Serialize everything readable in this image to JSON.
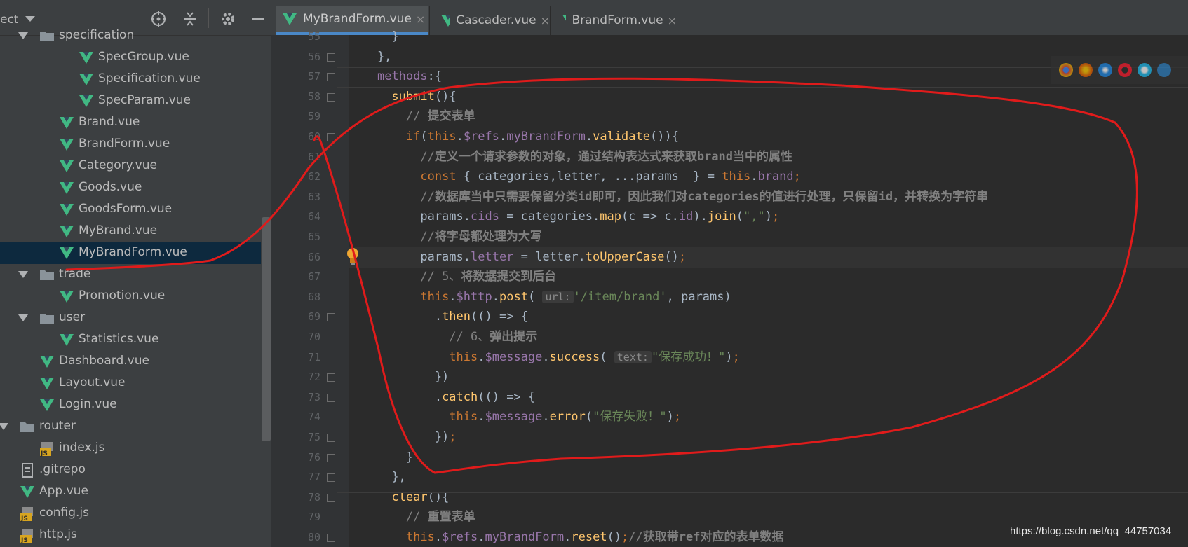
{
  "project_panel": {
    "title": "ect",
    "tree": [
      {
        "label": "specification",
        "indent": 2,
        "kind": "folder",
        "arrow": true
      },
      {
        "label": "SpecGroup.vue",
        "indent": 4,
        "kind": "vue"
      },
      {
        "label": "Specification.vue",
        "indent": 4,
        "kind": "vue"
      },
      {
        "label": "SpecParam.vue",
        "indent": 4,
        "kind": "vue"
      },
      {
        "label": "Brand.vue",
        "indent": 3,
        "kind": "vue"
      },
      {
        "label": "BrandForm.vue",
        "indent": 3,
        "kind": "vue"
      },
      {
        "label": "Category.vue",
        "indent": 3,
        "kind": "vue"
      },
      {
        "label": "Goods.vue",
        "indent": 3,
        "kind": "vue"
      },
      {
        "label": "GoodsForm.vue",
        "indent": 3,
        "kind": "vue"
      },
      {
        "label": "MyBrand.vue",
        "indent": 3,
        "kind": "vue"
      },
      {
        "label": "MyBrandForm.vue",
        "indent": 3,
        "kind": "vue",
        "selected": true
      },
      {
        "label": "trade",
        "indent": 2,
        "kind": "folder",
        "arrow": true
      },
      {
        "label": "Promotion.vue",
        "indent": 3,
        "kind": "vue"
      },
      {
        "label": "user",
        "indent": 2,
        "kind": "folder",
        "arrow": true
      },
      {
        "label": "Statistics.vue",
        "indent": 3,
        "kind": "vue"
      },
      {
        "label": "Dashboard.vue",
        "indent": 2,
        "kind": "vue"
      },
      {
        "label": "Layout.vue",
        "indent": 2,
        "kind": "vue"
      },
      {
        "label": "Login.vue",
        "indent": 2,
        "kind": "vue"
      },
      {
        "label": "router",
        "indent": 1,
        "kind": "folder",
        "arrow": true
      },
      {
        "label": "index.js",
        "indent": 2,
        "kind": "js"
      },
      {
        "label": ".gitrepo",
        "indent": 1,
        "kind": "file"
      },
      {
        "label": "App.vue",
        "indent": 1,
        "kind": "vue"
      },
      {
        "label": "config.js",
        "indent": 1,
        "kind": "js"
      },
      {
        "label": "http.js",
        "indent": 1,
        "kind": "js"
      }
    ]
  },
  "tabs": [
    {
      "label": "MyBrandForm.vue",
      "active": true
    },
    {
      "label": "Cascader.vue",
      "active": false
    },
    {
      "label": "BrandForm.vue",
      "active": false
    }
  ],
  "editor": {
    "current_line": 66,
    "lines": [
      {
        "n": "55",
        "fold": false,
        "tokens": [
          [
            "tx",
            "      "
          ],
          [
            "tx",
            "}"
          ]
        ]
      },
      {
        "n": "56",
        "fold": true,
        "tokens": [
          [
            "tx",
            "    },"
          ]
        ]
      },
      {
        "n": "57",
        "fold": true,
        "tokens": [
          [
            "tx",
            "    "
          ],
          [
            "pr",
            "methods"
          ],
          [
            "tx",
            ":{"
          ]
        ]
      },
      {
        "n": "58",
        "fold": true,
        "tokens": [
          [
            "tx",
            "      "
          ],
          [
            "fn",
            "submit"
          ],
          [
            "tx",
            "(){"
          ]
        ]
      },
      {
        "n": "59",
        "fold": false,
        "tokens": [
          [
            "tx",
            "        "
          ],
          [
            "cmt",
            "// "
          ],
          [
            "cmtb",
            "提交表单"
          ]
        ]
      },
      {
        "n": "60",
        "fold": true,
        "tokens": [
          [
            "tx",
            "        "
          ],
          [
            "kw",
            "if"
          ],
          [
            "tx",
            "("
          ],
          [
            "kw",
            "this"
          ],
          [
            "tx",
            "."
          ],
          [
            "pr",
            "$refs"
          ],
          [
            "tx",
            "."
          ],
          [
            "pr",
            "myBrandForm"
          ],
          [
            "tx",
            "."
          ],
          [
            "fn",
            "validate"
          ],
          [
            "tx",
            "()){"
          ]
        ]
      },
      {
        "n": "61",
        "fold": false,
        "tokens": [
          [
            "tx",
            "          "
          ],
          [
            "cmt",
            "//"
          ],
          [
            "cmtb",
            "定义一个请求参数的对象，通过结构表达式来获取brand当中的属性"
          ]
        ]
      },
      {
        "n": "62",
        "fold": false,
        "tokens": [
          [
            "tx",
            "          "
          ],
          [
            "kw",
            "const"
          ],
          [
            "tx",
            " { categories,letter, ...params  } = "
          ],
          [
            "kw",
            "this"
          ],
          [
            "tx",
            "."
          ],
          [
            "pr",
            "brand"
          ],
          [
            "kw",
            ";"
          ]
        ]
      },
      {
        "n": "63",
        "fold": false,
        "tokens": [
          [
            "tx",
            "          "
          ],
          [
            "cmt",
            "//"
          ],
          [
            "cmtb",
            "数据库当中只需要保留分类id即可，因此我们对categories的值进行处理，只保留id，并转换为字符串"
          ]
        ]
      },
      {
        "n": "64",
        "fold": false,
        "tokens": [
          [
            "tx",
            "          params."
          ],
          [
            "pr",
            "cids"
          ],
          [
            "tx",
            " = categories."
          ],
          [
            "fn",
            "map"
          ],
          [
            "tx",
            "(c => c."
          ],
          [
            "pr",
            "id"
          ],
          [
            "tx",
            ")."
          ],
          [
            "fn",
            "join"
          ],
          [
            "tx",
            "("
          ],
          [
            "str",
            "\",\""
          ],
          [
            "tx",
            ")"
          ],
          [
            "kw",
            ";"
          ]
        ]
      },
      {
        "n": "65",
        "fold": false,
        "tokens": [
          [
            "tx",
            "          "
          ],
          [
            "cmt",
            "//"
          ],
          [
            "cmtb",
            "将字母都处理为大写"
          ]
        ]
      },
      {
        "n": "66",
        "fold": false,
        "tokens": [
          [
            "tx",
            "          params."
          ],
          [
            "pr",
            "letter"
          ],
          [
            "tx",
            " = letter."
          ],
          [
            "fn",
            "toUpperCase"
          ],
          [
            "tx",
            "()"
          ],
          [
            "kw",
            ";"
          ]
        ]
      },
      {
        "n": "67",
        "fold": false,
        "tokens": [
          [
            "tx",
            "          "
          ],
          [
            "cmt",
            "// 5、"
          ],
          [
            "cmtb",
            "将数据提交到后台"
          ]
        ]
      },
      {
        "n": "68",
        "fold": false,
        "tokens": [
          [
            "tx",
            "          "
          ],
          [
            "kw",
            "this"
          ],
          [
            "tx",
            "."
          ],
          [
            "pr",
            "$http"
          ],
          [
            "tx",
            "."
          ],
          [
            "fn",
            "post"
          ],
          [
            "tx",
            "( "
          ],
          [
            "hint",
            "url:"
          ],
          [
            "str",
            "'/item/brand'"
          ],
          [
            "tx",
            ", params)"
          ]
        ]
      },
      {
        "n": "69",
        "fold": true,
        "tokens": [
          [
            "tx",
            "            ."
          ],
          [
            "fn",
            "then"
          ],
          [
            "tx",
            "(() => {"
          ]
        ]
      },
      {
        "n": "70",
        "fold": false,
        "tokens": [
          [
            "tx",
            "              "
          ],
          [
            "cmt",
            "// 6、"
          ],
          [
            "cmtb",
            "弹出提示"
          ]
        ]
      },
      {
        "n": "71",
        "fold": false,
        "tokens": [
          [
            "tx",
            "              "
          ],
          [
            "kw",
            "this"
          ],
          [
            "tx",
            "."
          ],
          [
            "pr",
            "$message"
          ],
          [
            "tx",
            "."
          ],
          [
            "fn",
            "success"
          ],
          [
            "tx",
            "( "
          ],
          [
            "hint",
            "text:"
          ],
          [
            "str",
            "\"保存成功！\""
          ],
          [
            "tx",
            ")"
          ],
          [
            "kw",
            ";"
          ]
        ]
      },
      {
        "n": "72",
        "fold": true,
        "tokens": [
          [
            "tx",
            "            })"
          ]
        ]
      },
      {
        "n": "73",
        "fold": true,
        "tokens": [
          [
            "tx",
            "            ."
          ],
          [
            "fn",
            "catch"
          ],
          [
            "tx",
            "(() => {"
          ]
        ]
      },
      {
        "n": "74",
        "fold": false,
        "tokens": [
          [
            "tx",
            "              "
          ],
          [
            "kw",
            "this"
          ],
          [
            "tx",
            "."
          ],
          [
            "pr",
            "$message"
          ],
          [
            "tx",
            "."
          ],
          [
            "fn",
            "error"
          ],
          [
            "tx",
            "("
          ],
          [
            "str",
            "\"保存失败！\""
          ],
          [
            "tx",
            ")"
          ],
          [
            "kw",
            ";"
          ]
        ]
      },
      {
        "n": "75",
        "fold": true,
        "tokens": [
          [
            "tx",
            "            })"
          ],
          [
            "kw",
            ";"
          ]
        ]
      },
      {
        "n": "76",
        "fold": true,
        "tokens": [
          [
            "tx",
            "        }"
          ]
        ]
      },
      {
        "n": "77",
        "fold": true,
        "tokens": [
          [
            "tx",
            "      },"
          ]
        ]
      },
      {
        "n": "78",
        "fold": true,
        "tokens": [
          [
            "tx",
            "      "
          ],
          [
            "fn",
            "clear"
          ],
          [
            "tx",
            "(){"
          ]
        ]
      },
      {
        "n": "79",
        "fold": false,
        "tokens": [
          [
            "tx",
            "        "
          ],
          [
            "cmt",
            "// "
          ],
          [
            "cmtb",
            "重置表单"
          ]
        ]
      },
      {
        "n": "80",
        "fold": true,
        "tokens": [
          [
            "tx",
            "        "
          ],
          [
            "kw",
            "this"
          ],
          [
            "tx",
            "."
          ],
          [
            "pr",
            "$refs"
          ],
          [
            "tx",
            "."
          ],
          [
            "pr",
            "myBrandForm"
          ],
          [
            "tx",
            "."
          ],
          [
            "fn",
            "reset"
          ],
          [
            "tx",
            "()"
          ],
          [
            "kw",
            ";"
          ],
          [
            "cmt",
            "//"
          ],
          [
            "cmtb",
            "获取带ref对应的表单数据"
          ]
        ]
      }
    ]
  },
  "watermark": "https://blog.csdn.net/qq_44757034",
  "colors": {
    "vue_icon": "#41b883",
    "annotation": "#e01b1b",
    "selection": "#0d293e"
  }
}
